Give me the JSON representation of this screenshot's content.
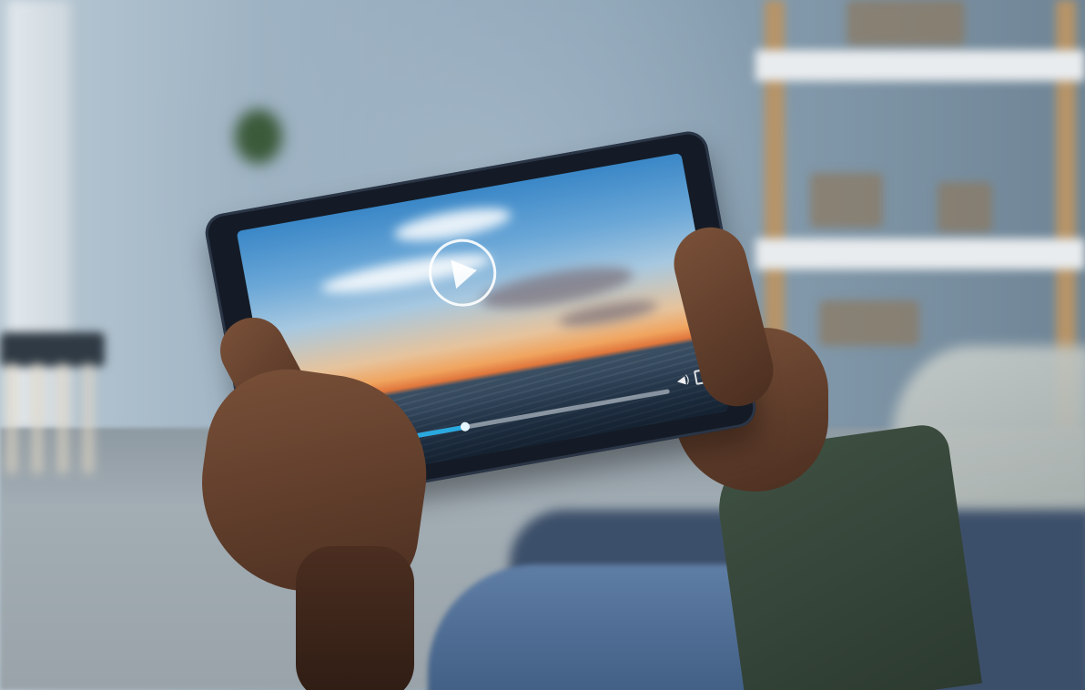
{
  "scene": {
    "description_colors": {
      "wall": "#9db2c2",
      "accent_progress": "#29a9e0",
      "tablet_bezel": "#141b26"
    }
  },
  "video_player": {
    "progress_fraction": 0.34,
    "icons": {
      "play": "play-icon",
      "pause": "pause-icon",
      "fast_forward": "fast-forward-icon",
      "volume": "volume-icon",
      "fullscreen": "fullscreen-icon"
    },
    "pause_glyph": "❚❚",
    "ff_glyph": "▶▶",
    "volume_glyph": "◀)"
  }
}
